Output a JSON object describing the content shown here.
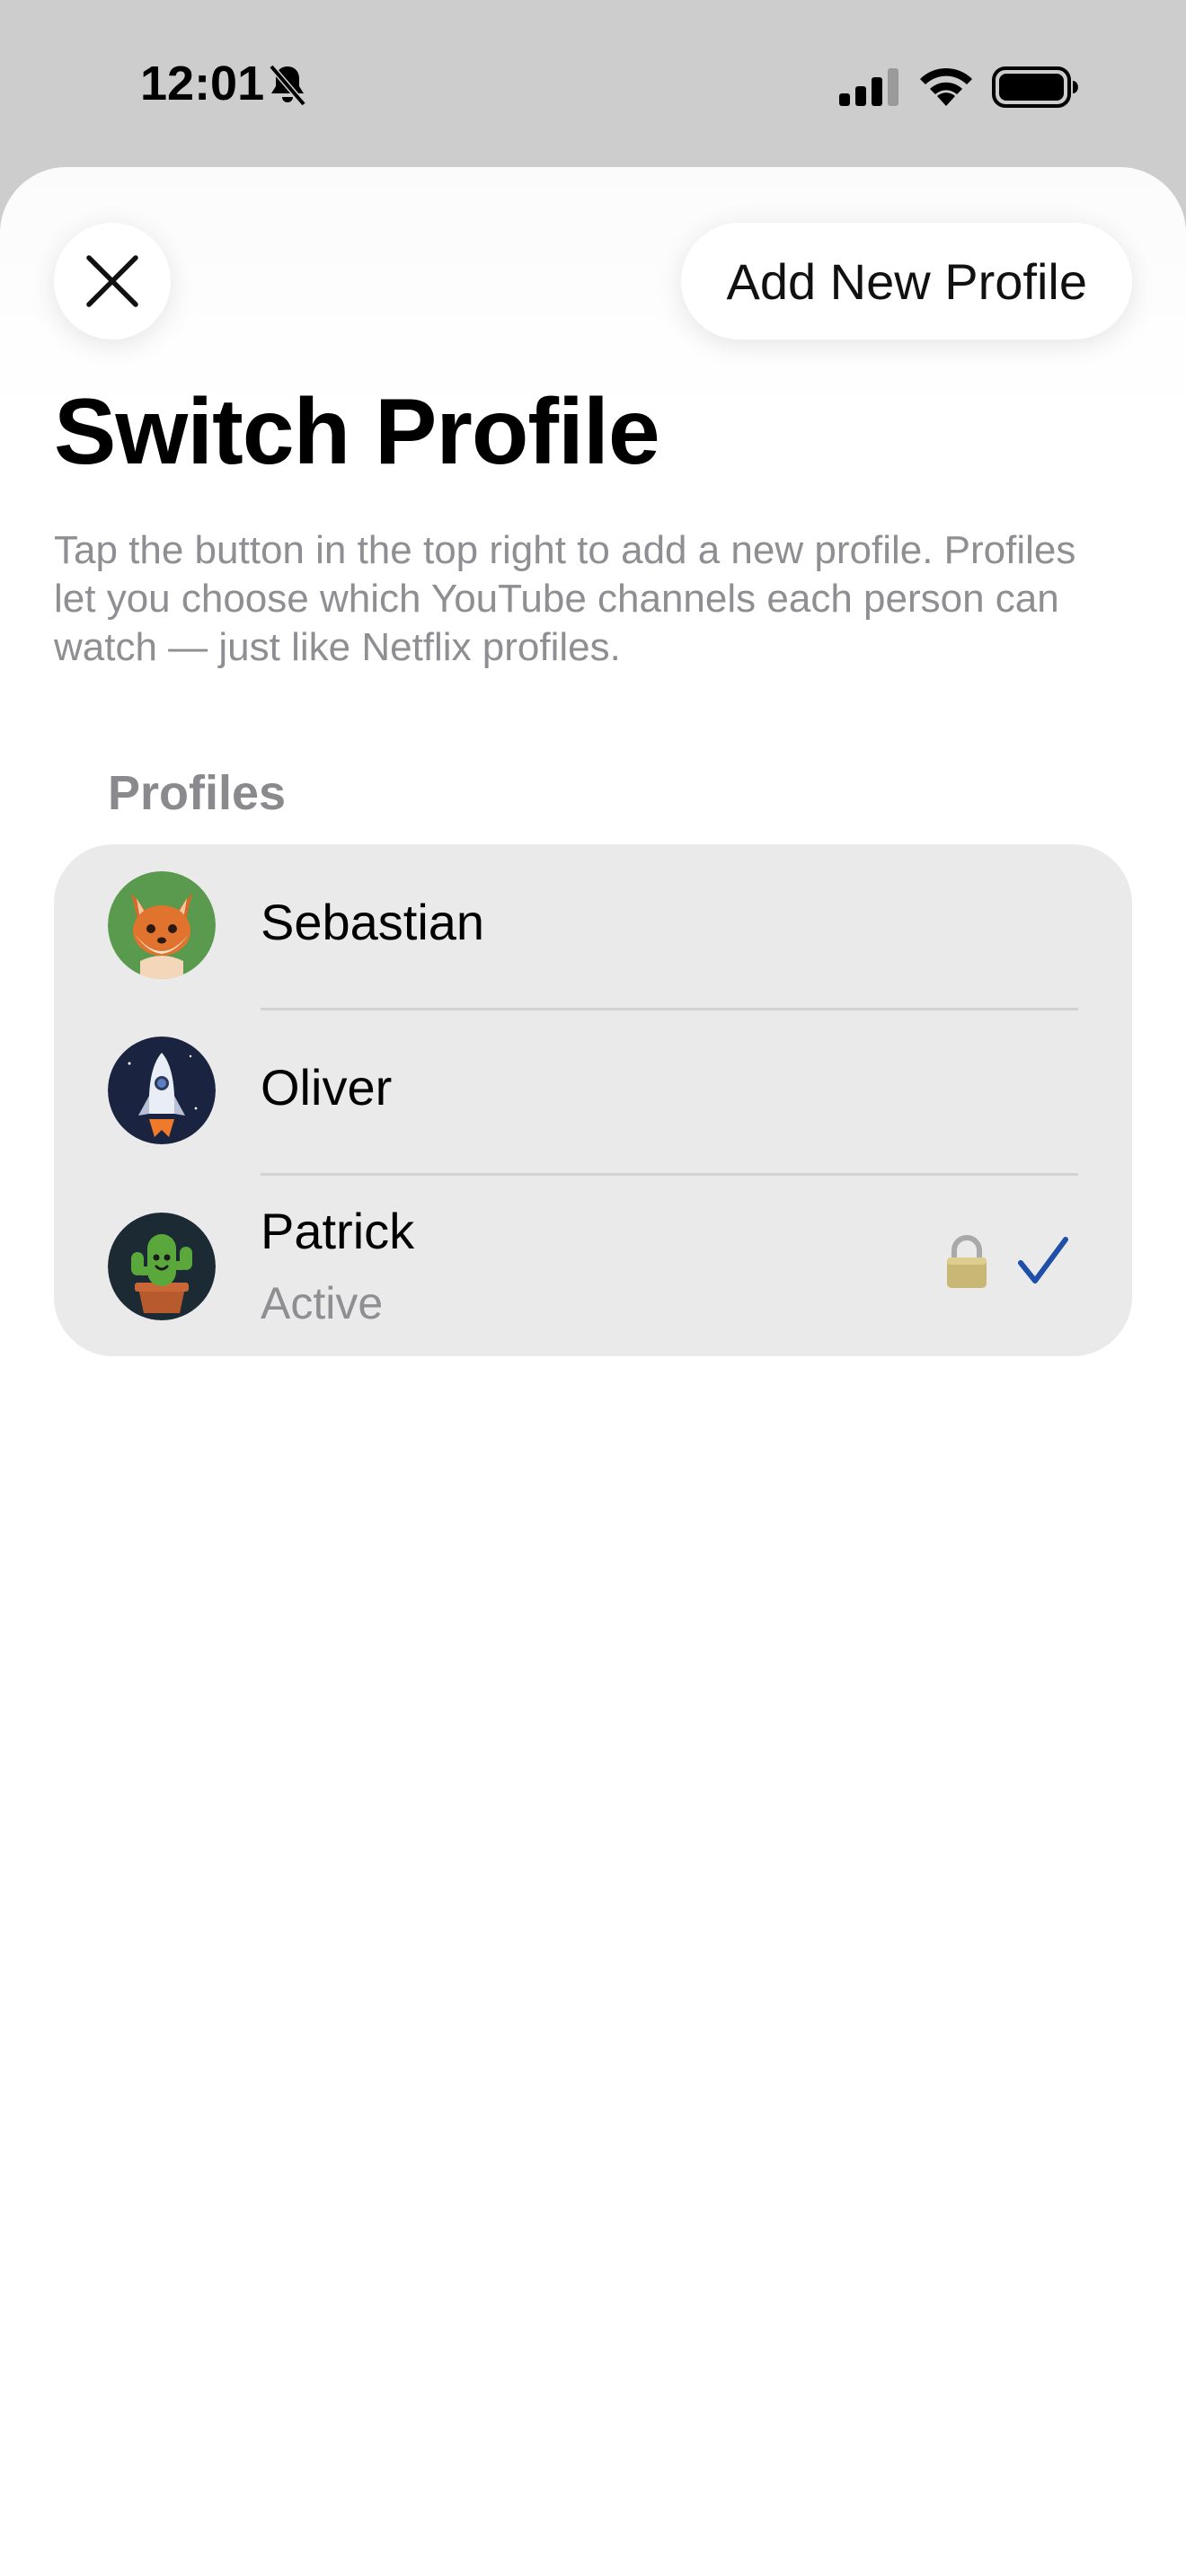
{
  "status_bar": {
    "time": "12:01",
    "icons": [
      "bell-slash-icon",
      "cellular-signal-icon",
      "wifi-icon",
      "battery-icon"
    ]
  },
  "header": {
    "close_icon": "close-icon",
    "add_button_label": "Add New Profile"
  },
  "page": {
    "title": "Switch Profile",
    "description": "Tap the button in the top right to add a new profile. Profiles let you choose which YouTube channels each person can watch — just like Netflix profiles."
  },
  "profiles": {
    "section_label": "Profiles",
    "items": [
      {
        "name": "Sebastian",
        "avatar": "fox-avatar",
        "subtitle": "",
        "locked": false,
        "selected": false
      },
      {
        "name": "Oliver",
        "avatar": "rocket-avatar",
        "subtitle": "",
        "locked": false,
        "selected": false
      },
      {
        "name": "Patrick",
        "avatar": "cactus-avatar",
        "subtitle": "Active",
        "locked": true,
        "selected": true
      }
    ]
  },
  "colors": {
    "accent": "#1f4fa8",
    "card_background": "#eaeaea",
    "secondary_text": "#8e8e93",
    "status_bar_background": "#cdcdcd"
  }
}
